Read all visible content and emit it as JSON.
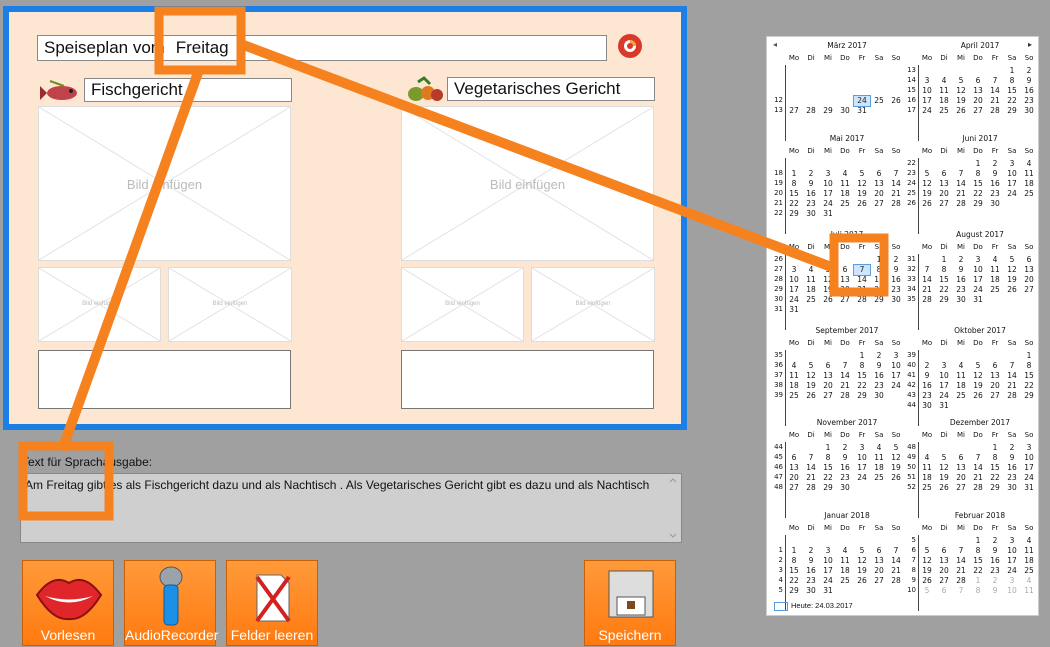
{
  "editor": {
    "title_prefix": "Speiseplan vom",
    "day_value": "Freitag",
    "section_left": {
      "title": "Fischgericht",
      "icon": "fish-icon"
    },
    "section_right": {
      "title": "Vegetarisches Gericht",
      "icon": "vegetables-icon"
    },
    "image_placeholder": "Bild einfügen",
    "image_placeholder_small": "Bild einfügen"
  },
  "speech": {
    "label": "Text für Sprachausgabe:",
    "text": "Am Freitag gibt es als Fischgericht  dazu  und als Nachtisch . Als Vegetarisches Gericht gibt es  dazu  und als Nachtisch ."
  },
  "buttons": {
    "read": "Vorlesen",
    "recorder": "AudioRecorder",
    "clear": "Felder leeren",
    "save": "Speichern"
  },
  "calendar": {
    "prev": "◂",
    "next": "▸",
    "weekdays": [
      "Mo",
      "Di",
      "Mi",
      "Do",
      "Fr",
      "Sa",
      "So"
    ],
    "today_label": "Heute: 24.03.2017",
    "months": [
      {
        "title": "März 2017",
        "weeks": [
          "",
          "",
          "",
          "",
          "13"
        ],
        "rows": [
          [
            "",
            "",
            "",
            "",
            "",
            "",
            ""
          ],
          [
            "",
            "",
            "",
            "",
            "",
            "",
            ""
          ],
          [
            "",
            "",
            "",
            "",
            "",
            "",
            ""
          ],
          [
            "",
            "",
            "",
            "",
            "24",
            "25",
            "26"
          ],
          [
            "27",
            "28",
            "29",
            "30",
            "31",
            "",
            ""
          ]
        ],
        "wknums": [
          "",
          "",
          "",
          "12",
          "13"
        ],
        "sel": "24"
      },
      {
        "title": "April 2017",
        "wknums": [
          "13",
          "14",
          "15",
          "16",
          "17"
        ],
        "rows": [
          [
            "",
            "",
            "",
            "",
            "",
            "1",
            "2"
          ],
          [
            "3",
            "4",
            "5",
            "6",
            "7",
            "8",
            "9"
          ],
          [
            "10",
            "11",
            "12",
            "13",
            "14",
            "15",
            "16"
          ],
          [
            "17",
            "18",
            "19",
            "20",
            "21",
            "22",
            "23"
          ],
          [
            "24",
            "25",
            "26",
            "27",
            "28",
            "29",
            "30"
          ]
        ]
      },
      {
        "title": "Mai 2017",
        "wknums": [
          "",
          "18",
          "19",
          "20",
          "21",
          "22"
        ],
        "rows": [
          [
            "",
            "",
            "",
            "",
            "",
            "",
            ""
          ],
          [
            "1",
            "2",
            "3",
            "4",
            "5",
            "6",
            "7"
          ],
          [
            "8",
            "9",
            "10",
            "11",
            "12",
            "13",
            "14"
          ],
          [
            "15",
            "16",
            "17",
            "18",
            "19",
            "20",
            "21"
          ],
          [
            "22",
            "23",
            "24",
            "25",
            "26",
            "27",
            "28"
          ],
          [
            "29",
            "30",
            "31",
            "",
            "",
            "",
            ""
          ]
        ]
      },
      {
        "title": "Juni 2017",
        "wknums": [
          "22",
          "23",
          "24",
          "25",
          "26"
        ],
        "rows": [
          [
            "",
            "",
            "",
            "1",
            "2",
            "3",
            "4"
          ],
          [
            "5",
            "6",
            "7",
            "8",
            "9",
            "10",
            "11"
          ],
          [
            "12",
            "13",
            "14",
            "15",
            "16",
            "17",
            "18"
          ],
          [
            "19",
            "20",
            "21",
            "22",
            "23",
            "24",
            "25"
          ],
          [
            "26",
            "27",
            "28",
            "29",
            "30",
            "",
            ""
          ]
        ]
      },
      {
        "title": "Juli 2017",
        "wknums": [
          "26",
          "27",
          "28",
          "29",
          "30",
          "31"
        ],
        "rows": [
          [
            "",
            "",
            "",
            "",
            "",
            "1",
            "2"
          ],
          [
            "3",
            "4",
            "5",
            "6",
            "7",
            "8",
            "9"
          ],
          [
            "10",
            "11",
            "12",
            "13",
            "14",
            "15",
            "16"
          ],
          [
            "17",
            "18",
            "19",
            "20",
            "21",
            "22",
            "23"
          ],
          [
            "24",
            "25",
            "26",
            "27",
            "28",
            "29",
            "30"
          ],
          [
            "31",
            "",
            "",
            "",
            "",
            "",
            ""
          ]
        ],
        "sel": "7"
      },
      {
        "title": "August 2017",
        "wknums": [
          "31",
          "32",
          "33",
          "34",
          "35"
        ],
        "rows": [
          [
            "",
            "1",
            "2",
            "3",
            "4",
            "5",
            "6"
          ],
          [
            "7",
            "8",
            "9",
            "10",
            "11",
            "12",
            "13"
          ],
          [
            "14",
            "15",
            "16",
            "17",
            "18",
            "19",
            "20"
          ],
          [
            "21",
            "22",
            "23",
            "24",
            "25",
            "26",
            "27"
          ],
          [
            "28",
            "29",
            "30",
            "31",
            "",
            "",
            ""
          ]
        ]
      },
      {
        "title": "September 2017",
        "wknums": [
          "35",
          "36",
          "37",
          "38",
          "39"
        ],
        "rows": [
          [
            "",
            "",
            "",
            "",
            "1",
            "2",
            "3"
          ],
          [
            "4",
            "5",
            "6",
            "7",
            "8",
            "9",
            "10"
          ],
          [
            "11",
            "12",
            "13",
            "14",
            "15",
            "16",
            "17"
          ],
          [
            "18",
            "19",
            "20",
            "21",
            "22",
            "23",
            "24"
          ],
          [
            "25",
            "26",
            "27",
            "28",
            "29",
            "30",
            ""
          ]
        ]
      },
      {
        "title": "Oktober 2017",
        "wknums": [
          "39",
          "40",
          "41",
          "42",
          "43",
          "44"
        ],
        "rows": [
          [
            "",
            "",
            "",
            "",
            "",
            "",
            "1"
          ],
          [
            "2",
            "3",
            "4",
            "5",
            "6",
            "7",
            "8"
          ],
          [
            "9",
            "10",
            "11",
            "12",
            "13",
            "14",
            "15"
          ],
          [
            "16",
            "17",
            "18",
            "19",
            "20",
            "21",
            "22"
          ],
          [
            "23",
            "24",
            "25",
            "26",
            "27",
            "28",
            "29"
          ],
          [
            "30",
            "31",
            "",
            "",
            "",
            "",
            ""
          ]
        ]
      },
      {
        "title": "November 2017",
        "wknums": [
          "44",
          "45",
          "46",
          "47",
          "48"
        ],
        "rows": [
          [
            "",
            "",
            "1",
            "2",
            "3",
            "4",
            "5"
          ],
          [
            "6",
            "7",
            "8",
            "9",
            "10",
            "11",
            "12"
          ],
          [
            "13",
            "14",
            "15",
            "16",
            "17",
            "18",
            "19"
          ],
          [
            "20",
            "21",
            "22",
            "23",
            "24",
            "25",
            "26"
          ],
          [
            "27",
            "28",
            "29",
            "30",
            "",
            "",
            ""
          ]
        ]
      },
      {
        "title": "Dezember 2017",
        "wknums": [
          "48",
          "49",
          "50",
          "51",
          "52"
        ],
        "rows": [
          [
            "",
            "",
            "",
            "",
            "1",
            "2",
            "3"
          ],
          [
            "4",
            "5",
            "6",
            "7",
            "8",
            "9",
            "10"
          ],
          [
            "11",
            "12",
            "13",
            "14",
            "15",
            "16",
            "17"
          ],
          [
            "18",
            "19",
            "20",
            "21",
            "22",
            "23",
            "24"
          ],
          [
            "25",
            "26",
            "27",
            "28",
            "29",
            "30",
            "31"
          ]
        ]
      },
      {
        "title": "Januar 2018",
        "wknums": [
          "",
          "1",
          "2",
          "3",
          "4",
          "5"
        ],
        "rows": [
          [
            "",
            "",
            "",
            "",
            "",
            "",
            ""
          ],
          [
            "1",
            "2",
            "3",
            "4",
            "5",
            "6",
            "7"
          ],
          [
            "8",
            "9",
            "10",
            "11",
            "12",
            "13",
            "14"
          ],
          [
            "15",
            "16",
            "17",
            "18",
            "19",
            "20",
            "21"
          ],
          [
            "22",
            "23",
            "24",
            "25",
            "26",
            "27",
            "28"
          ],
          [
            "29",
            "30",
            "31",
            "",
            "",
            "",
            ""
          ]
        ]
      },
      {
        "title": "Februar 2018",
        "wknums": [
          "5",
          "6",
          "7",
          "8",
          "9",
          "10"
        ],
        "rows": [
          [
            "",
            "",
            "",
            "1",
            "2",
            "3",
            "4"
          ],
          [
            "5",
            "6",
            "7",
            "8",
            "9",
            "10",
            "11"
          ],
          [
            "12",
            "13",
            "14",
            "15",
            "16",
            "17",
            "18"
          ],
          [
            "19",
            "20",
            "21",
            "22",
            "23",
            "24",
            "25"
          ],
          [
            "26",
            "27",
            "28",
            "1",
            "2",
            "3",
            "4"
          ],
          [
            "5",
            "6",
            "7",
            "8",
            "9",
            "10",
            "11"
          ]
        ],
        "grey_from": [
          4,
          3
        ]
      }
    ]
  },
  "colors": {
    "frame_blue": "#1b7fe6",
    "panel_peach": "#fde7d2",
    "accent_orange": "#f5821f",
    "button_orange": "#ff8a20"
  }
}
